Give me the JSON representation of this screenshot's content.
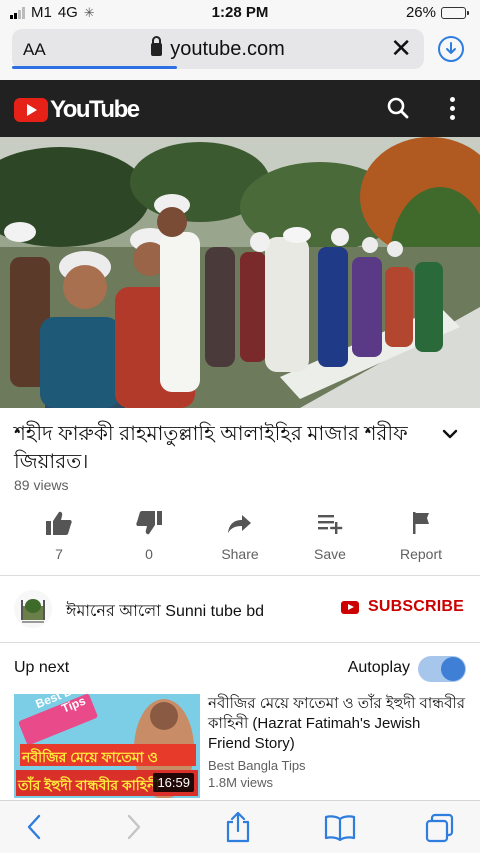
{
  "status_bar": {
    "carrier": "M1",
    "network": "4G",
    "time": "1:28 PM",
    "battery": "26%",
    "battery_level": 0.26
  },
  "browser": {
    "reader_label": "AA",
    "url": "youtube.com",
    "load_progress": 0.4,
    "accent_color": "#2f7ddf"
  },
  "youtube_header": {
    "logo_text": "YouTube",
    "brand_color": "#e62117",
    "icons": [
      "search-icon",
      "more-vert-icon"
    ]
  },
  "video": {
    "title": "শহীদ ফারুকী রাহমাতুল্লাহি আলাইহির মাজার শরীফ জিয়ারত।",
    "views": "89 views"
  },
  "actions": [
    {
      "icon": "thumbs-up-icon",
      "label": "7"
    },
    {
      "icon": "thumbs-down-icon",
      "label": "0"
    },
    {
      "icon": "share-icon",
      "label": "Share"
    },
    {
      "icon": "save-playlist-icon",
      "label": "Save"
    },
    {
      "icon": "report-flag-icon",
      "label": "Report"
    }
  ],
  "channel": {
    "name": "ঈমানের আলো Sunni tube bd",
    "subscribe_label": "SUBSCRIBE",
    "subscribe_color": "#cc0000"
  },
  "up_next": {
    "heading": "Up next",
    "autoplay_label": "Autoplay",
    "autoplay_on": true
  },
  "recommendation": {
    "title": "নবীজির মেয়ে ফাতেমা ও তাঁর ইহুদী বান্ধবীর কাহিনী (Hazrat Fatimah's Jewish Friend Story)",
    "channel": "Best Bangla Tips",
    "views": "1.8M views",
    "duration": "16:59",
    "thumb_badge": "Best Bangla Tips",
    "thumb_caption_1": "নবীজির মেয়ে ফাতেমা ও",
    "thumb_caption_2": "তাঁর ইহুদী বান্ধবীর কাহিনী"
  },
  "toolbar": {
    "icons": [
      "back-icon",
      "forward-icon",
      "share-sheet-icon",
      "bookmarks-icon",
      "tabs-icon"
    ]
  }
}
